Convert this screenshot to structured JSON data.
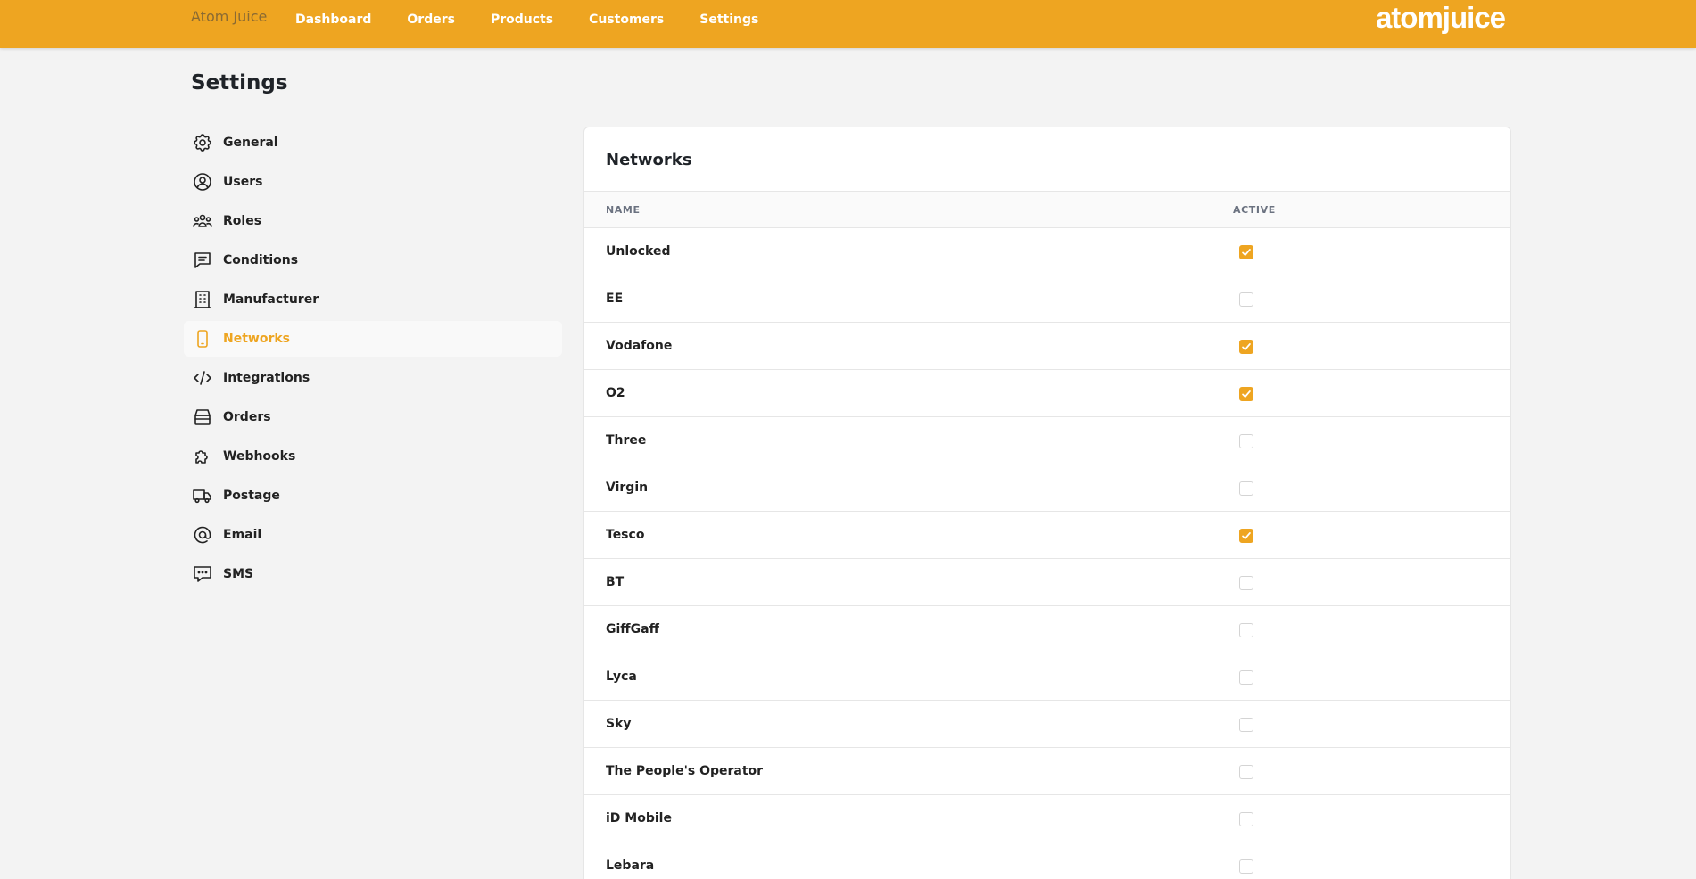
{
  "header": {
    "brand": "Atom Juice",
    "logo": "atomjuice",
    "nav": [
      "Dashboard",
      "Orders",
      "Products",
      "Customers",
      "Settings"
    ],
    "accent_color": "#eea521"
  },
  "page": {
    "title": "Settings"
  },
  "sidebar": {
    "items": [
      {
        "label": "General",
        "icon": "gear-icon"
      },
      {
        "label": "Users",
        "icon": "user-circle-icon"
      },
      {
        "label": "Roles",
        "icon": "user-group-icon"
      },
      {
        "label": "Conditions",
        "icon": "message-list-icon"
      },
      {
        "label": "Manufacturer",
        "icon": "building-icon"
      },
      {
        "label": "Networks",
        "icon": "mobile-phone-icon",
        "active": true
      },
      {
        "label": "Integrations",
        "icon": "code-icon"
      },
      {
        "label": "Orders",
        "icon": "archive-box-icon"
      },
      {
        "label": "Webhooks",
        "icon": "puzzle-icon"
      },
      {
        "label": "Postage",
        "icon": "truck-icon"
      },
      {
        "label": "Email",
        "icon": "at-sign-icon"
      },
      {
        "label": "SMS",
        "icon": "chat-bubble-icon"
      }
    ]
  },
  "networks": {
    "title": "Networks",
    "columns": {
      "name": "NAME",
      "active": "ACTIVE"
    },
    "rows": [
      {
        "name": "Unlocked",
        "active": true
      },
      {
        "name": "EE",
        "active": false
      },
      {
        "name": "Vodafone",
        "active": true
      },
      {
        "name": "O2",
        "active": true
      },
      {
        "name": "Three",
        "active": false
      },
      {
        "name": "Virgin",
        "active": false
      },
      {
        "name": "Tesco",
        "active": true
      },
      {
        "name": "BT",
        "active": false
      },
      {
        "name": "GiffGaff",
        "active": false
      },
      {
        "name": "Lyca",
        "active": false
      },
      {
        "name": "Sky",
        "active": false
      },
      {
        "name": "The People's Operator",
        "active": false
      },
      {
        "name": "iD Mobile",
        "active": false
      },
      {
        "name": "Lebara",
        "active": false
      }
    ]
  }
}
